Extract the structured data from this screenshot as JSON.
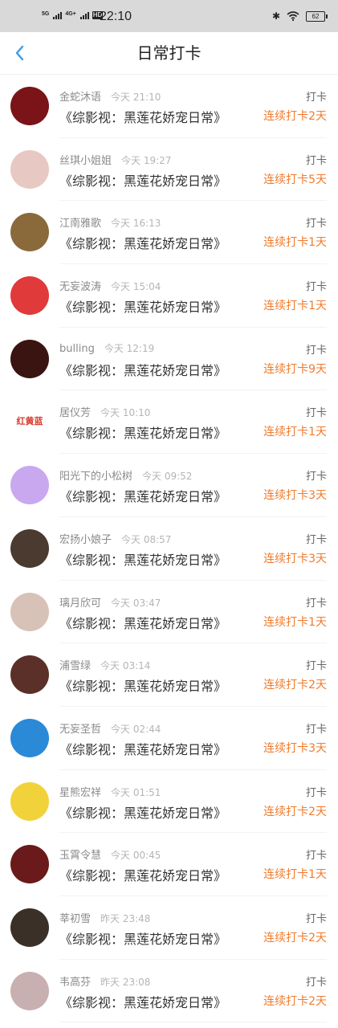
{
  "status_bar": {
    "network_left": "5G",
    "network_right": "4G+",
    "hd": "HD",
    "time": "22:10",
    "battery": "62"
  },
  "nav": {
    "back_icon": "chevron-left-icon",
    "title": "日常打卡"
  },
  "accent": "#f07b2d",
  "items": [
    {
      "name": "金蛇沐语",
      "time": "今天 21:10",
      "book": "《综影视：黑莲花娇宠日常》",
      "tag": "打卡",
      "streak": "连续打卡2天",
      "avatar_color": "#7a1418"
    },
    {
      "name": "丝琪小姐姐",
      "time": "今天 19:27",
      "book": "《综影视：黑莲花娇宠日常》",
      "tag": "打卡",
      "streak": "连续打卡5天",
      "avatar_color": "#e8c8c2"
    },
    {
      "name": "江南雅歌",
      "time": "今天 16:13",
      "book": "《综影视：黑莲花娇宠日常》",
      "tag": "打卡",
      "streak": "连续打卡1天",
      "avatar_color": "#8a6a3a"
    },
    {
      "name": "无妄波涛",
      "time": "今天 15:04",
      "book": "《综影视：黑莲花娇宠日常》",
      "tag": "打卡",
      "streak": "连续打卡1天",
      "avatar_color": "#e03a3a"
    },
    {
      "name": "bulling",
      "time": "今天 12:19",
      "book": "《综影视：黑莲花娇宠日常》",
      "tag": "打卡",
      "streak": "连续打卡9天",
      "avatar_color": "#3a1410"
    },
    {
      "name": "居仪芳",
      "time": "今天 10:10",
      "book": "《综影视：黑莲花娇宠日常》",
      "tag": "打卡",
      "streak": "连续打卡1天",
      "avatar_color": "#ffffff",
      "avatar_text": "红黄蓝"
    },
    {
      "name": "阳光下的小松树",
      "time": "今天 09:52",
      "book": "《综影视：黑莲花娇宠日常》",
      "tag": "打卡",
      "streak": "连续打卡3天",
      "avatar_color": "#c9a8f0"
    },
    {
      "name": "宏扬小娘子",
      "time": "今天 08:57",
      "book": "《综影视：黑莲花娇宠日常》",
      "tag": "打卡",
      "streak": "连续打卡3天",
      "avatar_color": "#4a3a30"
    },
    {
      "name": "璃月欣可",
      "time": "今天 03:47",
      "book": "《综影视：黑莲花娇宠日常》",
      "tag": "打卡",
      "streak": "连续打卡1天",
      "avatar_color": "#d8c2b8"
    },
    {
      "name": "浦雪绿",
      "time": "今天 03:14",
      "book": "《综影视：黑莲花娇宠日常》",
      "tag": "打卡",
      "streak": "连续打卡2天",
      "avatar_color": "#5a3028"
    },
    {
      "name": "无妄圣哲",
      "time": "今天 02:44",
      "book": "《综影视：黑莲花娇宠日常》",
      "tag": "打卡",
      "streak": "连续打卡3天",
      "avatar_color": "#2a8ad8"
    },
    {
      "name": "星熊宏祥",
      "time": "今天 01:51",
      "book": "《综影视：黑莲花娇宠日常》",
      "tag": "打卡",
      "streak": "连续打卡2天",
      "avatar_color": "#f2d23a"
    },
    {
      "name": "玉霄令慧",
      "time": "今天 00:45",
      "book": "《综影视：黑莲花娇宠日常》",
      "tag": "打卡",
      "streak": "连续打卡1天",
      "avatar_color": "#6a1a1a"
    },
    {
      "name": "莘初雪",
      "time": "昨天 23:48",
      "book": "《综影视：黑莲花娇宠日常》",
      "tag": "打卡",
      "streak": "连续打卡2天",
      "avatar_color": "#3a3028"
    },
    {
      "name": "韦高芬",
      "time": "昨天 23:08",
      "book": "《综影视：黑莲花娇宠日常》",
      "tag": "打卡",
      "streak": "连续打卡2天",
      "avatar_color": "#c8b0b0"
    }
  ]
}
